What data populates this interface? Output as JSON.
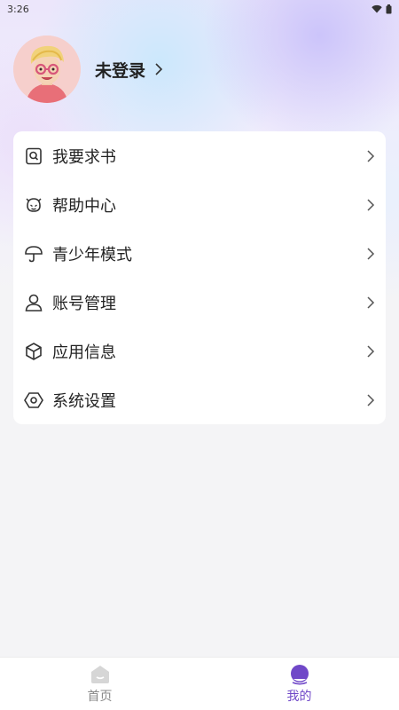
{
  "status_bar": {
    "time": "3:26",
    "icons": [
      "wifi-icon",
      "battery-icon"
    ]
  },
  "profile": {
    "login_status": "未登录",
    "avatar": "cartoon-avatar"
  },
  "menu": {
    "items": [
      {
        "label": "我要求书",
        "icon": "book-search-icon"
      },
      {
        "label": "帮助中心",
        "icon": "help-bot-icon"
      },
      {
        "label": "青少年模式",
        "icon": "umbrella-icon"
      },
      {
        "label": "账号管理",
        "icon": "user-icon"
      },
      {
        "label": "应用信息",
        "icon": "box-icon"
      },
      {
        "label": "系统设置",
        "icon": "settings-hex-icon"
      }
    ]
  },
  "tabbar": {
    "tabs": [
      {
        "label": "首页",
        "icon": "home-icon",
        "active": false
      },
      {
        "label": "我的",
        "icon": "profile-icon",
        "active": true
      }
    ]
  },
  "colors": {
    "accent": "#7048c8",
    "tab_inactive": "#888888",
    "card_bg": "#ffffff",
    "page_bg": "#f4f4f6"
  }
}
